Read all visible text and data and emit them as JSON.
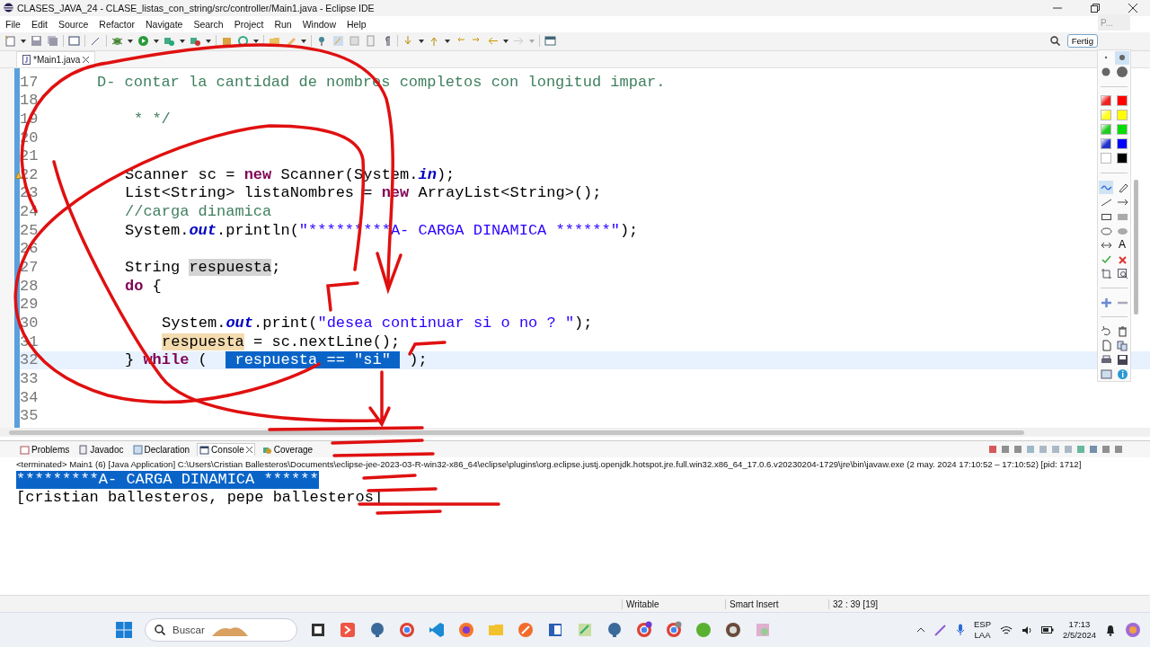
{
  "window": {
    "title": "CLASES_JAVA_24 - CLASE_listas_con_string/src/controller/Main1.java - Eclipse IDE"
  },
  "menu": [
    "File",
    "Edit",
    "Source",
    "Refactor",
    "Navigate",
    "Search",
    "Project",
    "Run",
    "Window",
    "Help"
  ],
  "quick_access": {
    "hint": "P...",
    "button": "Fertig"
  },
  "editor": {
    "tab": {
      "label": "*Main1.java"
    },
    "lines": [
      {
        "number": "17",
        "current": false,
        "warning": false,
        "kind": "comment",
        "segments": [
          {
            "kind": "comment",
            "text": "D- contar la cantidad de nombres completos con longitud impar."
          }
        ]
      },
      {
        "number": "18",
        "current": false,
        "warning": false
      },
      {
        "number": "19",
        "current": false,
        "warning": false,
        "kind": "javadoc-end",
        "segments": [
          {
            "kind": "comment",
            "text": "* */"
          }
        ]
      },
      {
        "number": "20",
        "current": false,
        "warning": false
      },
      {
        "number": "21",
        "current": false,
        "warning": false
      },
      {
        "number": "22",
        "current": false,
        "warning": true,
        "kind": "statement",
        "segments": [
          {
            "kind": "plain",
            "text": "Scanner sc = "
          },
          {
            "kind": "keyword",
            "text": "new"
          },
          {
            "kind": "plain",
            "text": " Scanner(System."
          },
          {
            "kind": "field",
            "text": "in"
          },
          {
            "kind": "plain",
            "text": ");"
          }
        ]
      },
      {
        "number": "23",
        "current": false,
        "warning": false,
        "kind": "statement",
        "segments": [
          {
            "kind": "plain",
            "text": "List<String> listaNombres = "
          },
          {
            "kind": "keyword",
            "text": "new"
          },
          {
            "kind": "plain",
            "text": " ArrayList<String>();"
          }
        ]
      },
      {
        "number": "24",
        "current": false,
        "warning": false,
        "kind": "statement",
        "segments": [
          {
            "kind": "comment",
            "text": "//carga dinamica"
          }
        ]
      },
      {
        "number": "25",
        "current": false,
        "warning": false,
        "kind": "statement",
        "segments": [
          {
            "kind": "plain",
            "text": "System."
          },
          {
            "kind": "field",
            "text": "out"
          },
          {
            "kind": "plain",
            "text": ".println("
          },
          {
            "kind": "string",
            "text": "\"*********A- CARGA DINAMICA ******\""
          },
          {
            "kind": "plain",
            "text": ");"
          }
        ]
      },
      {
        "number": "26",
        "current": false,
        "warning": false
      },
      {
        "number": "27",
        "current": false,
        "warning": false,
        "kind": "statement",
        "segments": [
          {
            "kind": "plain",
            "text": "String "
          },
          {
            "kind": "occurrence",
            "text": "respuesta"
          },
          {
            "kind": "plain",
            "text": ";"
          }
        ]
      },
      {
        "number": "28",
        "current": false,
        "warning": false,
        "kind": "statement",
        "segments": [
          {
            "kind": "keyword",
            "text": "do"
          },
          {
            "kind": "plain",
            "text": " {"
          }
        ]
      },
      {
        "number": "29",
        "current": false,
        "warning": false
      },
      {
        "number": "30",
        "current": false,
        "warning": false,
        "kind": "nested",
        "segments": [
          {
            "kind": "plain",
            "text": "System."
          },
          {
            "kind": "field",
            "text": "out"
          },
          {
            "kind": "plain",
            "text": ".print("
          },
          {
            "kind": "string",
            "text": "\"desea continuar si o no ? \""
          },
          {
            "kind": "plain",
            "text": ");"
          }
        ]
      },
      {
        "number": "31",
        "current": false,
        "warning": false,
        "kind": "nested",
        "segments": [
          {
            "kind": "write-occurrence",
            "text": "respuesta"
          },
          {
            "kind": "plain",
            "text": " = sc.nextLine();"
          }
        ]
      },
      {
        "number": "32",
        "current": true,
        "warning": false,
        "kind": "statement",
        "segments": [
          {
            "kind": "plain",
            "text": "} "
          },
          {
            "kind": "keyword",
            "text": "while"
          },
          {
            "kind": "plain",
            "text": " (  "
          },
          {
            "kind": "selection",
            "text": " respuesta == \"si\" "
          },
          {
            "kind": "plain",
            "text": " );"
          }
        ]
      },
      {
        "number": "33",
        "current": false,
        "warning": false
      },
      {
        "number": "34",
        "current": false,
        "warning": false
      },
      {
        "number": "35",
        "current": false,
        "warning": false
      }
    ]
  },
  "palette": {
    "pen_sizes": [
      {
        "selected": false
      },
      {
        "selected": true
      },
      {
        "selected": false
      },
      {
        "selected": false
      }
    ],
    "colors": [
      {
        "kind": "gradient",
        "color": "#ee2222"
      },
      {
        "kind": "solid",
        "color": "#ff0000"
      },
      {
        "kind": "gradient",
        "color": "#ffff22"
      },
      {
        "kind": "solid",
        "color": "#ffff00"
      },
      {
        "kind": "gradient",
        "color": "#22cc22"
      },
      {
        "kind": "solid",
        "color": "#00dd00"
      },
      {
        "kind": "gradient",
        "color": "#2233cc"
      },
      {
        "kind": "solid",
        "color": "#0000ff"
      },
      {
        "kind": "solid",
        "color": "#ffffff"
      },
      {
        "kind": "solid",
        "color": "#000000"
      }
    ],
    "tools": [
      {
        "kind": "freehand",
        "selected": true
      },
      {
        "kind": "eraser",
        "selected": false
      },
      {
        "kind": "line",
        "selected": false
      },
      {
        "kind": "arrow",
        "selected": false
      },
      {
        "kind": "rect",
        "selected": false
      },
      {
        "kind": "filled-rect",
        "selected": false
      },
      {
        "kind": "ellipse",
        "selected": false
      },
      {
        "kind": "filled-ellipse",
        "selected": false
      },
      {
        "kind": "double-arrow",
        "selected": false
      },
      {
        "kind": "text",
        "label": "A",
        "selected": false
      },
      {
        "kind": "check",
        "selected": false
      },
      {
        "kind": "cross",
        "selected": false
      },
      {
        "kind": "crop",
        "selected": false
      },
      {
        "kind": "zoom",
        "selected": false
      },
      {
        "kind": "plus",
        "selected": false
      },
      {
        "kind": "minus",
        "selected": false
      },
      {
        "kind": "undo",
        "selected": false
      },
      {
        "kind": "trash",
        "selected": false
      },
      {
        "kind": "page",
        "selected": false
      },
      {
        "kind": "copy",
        "selected": false
      },
      {
        "kind": "print",
        "selected": false
      },
      {
        "kind": "save",
        "selected": false
      },
      {
        "kind": "screen",
        "selected": false
      },
      {
        "kind": "info",
        "selected": false
      }
    ]
  },
  "console": {
    "tabs": [
      {
        "label": "Problems",
        "selected": false
      },
      {
        "label": "Javadoc",
        "selected": false
      },
      {
        "label": "Declaration",
        "selected": false
      },
      {
        "label": "Console",
        "selected": true
      },
      {
        "label": "Coverage",
        "selected": false
      }
    ],
    "header": "<terminated> Main1 (6) [Java Application] C:\\Users\\Cristian Ballesteros\\Documents\\eclipse-jee-2023-03-R-win32-x86_64\\eclipse\\plugins\\org.eclipse.justj.openjdk.hotspot.jre.full.win32.x86_64_17.0.6.v20230204-1729\\jre\\bin\\javaw.exe  (2 may. 2024 17:10:52 – 17:10:52) [pid: 1712]",
    "lines": [
      {
        "text": "*********A- CARGA DINAMICA ******",
        "selected": true
      },
      {
        "text": "[cristian ballesteros, pepe ballesteros]",
        "selected": false
      }
    ]
  },
  "status_bar": [
    "Writable",
    "Smart Insert",
    "32 : 39 [19]"
  ],
  "taskbar": {
    "search_placeholder": "Buscar",
    "language": "ESP",
    "layout": "LAA",
    "time": "17:13",
    "date": "2/5/2024"
  }
}
